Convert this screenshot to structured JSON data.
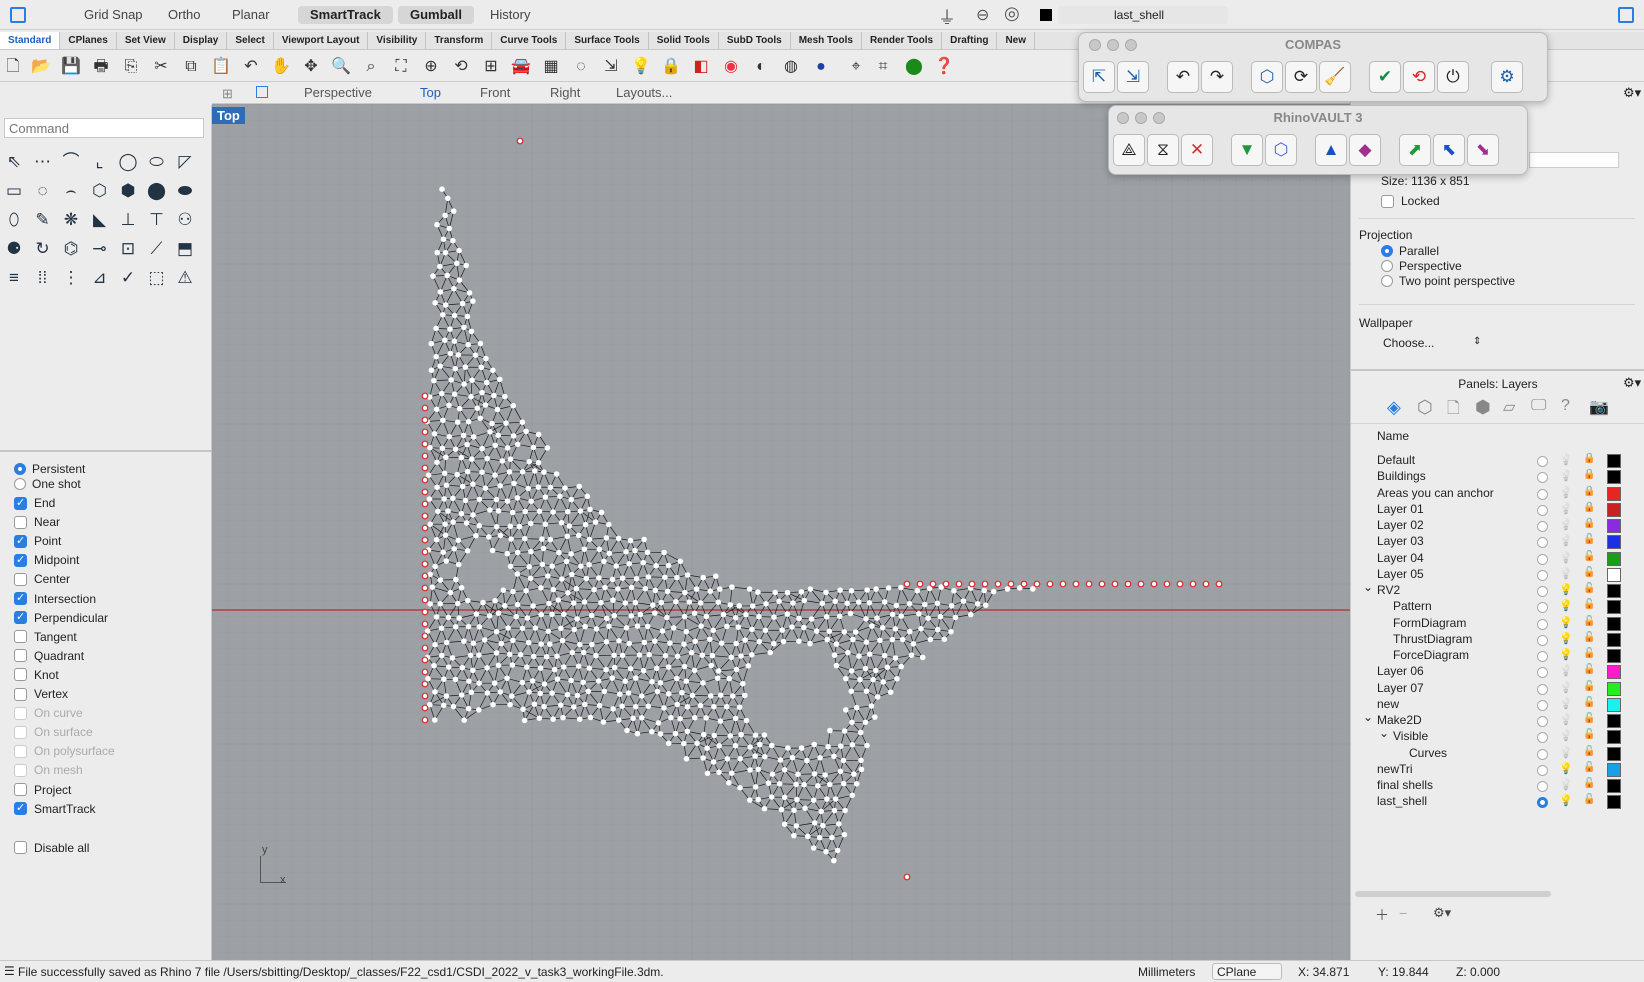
{
  "topbar": {
    "modes": [
      "Grid Snap",
      "Ortho",
      "Planar",
      "SmartTrack",
      "Gumball",
      "History"
    ],
    "active_modes": [
      "SmartTrack",
      "Gumball"
    ],
    "current_layer": "last_shell"
  },
  "tabs": [
    "Standard",
    "CPlanes",
    "Set View",
    "Display",
    "Select",
    "Viewport Layout",
    "Visibility",
    "Transform",
    "Curve Tools",
    "Surface Tools",
    "Solid Tools",
    "SubD Tools",
    "Mesh Tools",
    "Render Tools",
    "Drafting",
    "New"
  ],
  "command": {
    "placeholder": "Command"
  },
  "viewport_tabs": [
    "Perspective",
    "Top",
    "Front",
    "Right",
    "Layouts..."
  ],
  "viewport": {
    "label": "Top",
    "axis_x": "x",
    "axis_y": "y"
  },
  "osnap": {
    "modes": [
      {
        "label": "Persistent",
        "on": true
      },
      {
        "label": "One shot",
        "on": false
      }
    ],
    "items": [
      {
        "label": "End",
        "on": true,
        "enabled": true
      },
      {
        "label": "Near",
        "on": false,
        "enabled": true
      },
      {
        "label": "Point",
        "on": true,
        "enabled": true
      },
      {
        "label": "Midpoint",
        "on": true,
        "enabled": true
      },
      {
        "label": "Center",
        "on": false,
        "enabled": true
      },
      {
        "label": "Intersection",
        "on": true,
        "enabled": true
      },
      {
        "label": "Perpendicular",
        "on": true,
        "enabled": true
      },
      {
        "label": "Tangent",
        "on": false,
        "enabled": true
      },
      {
        "label": "Quadrant",
        "on": false,
        "enabled": true
      },
      {
        "label": "Knot",
        "on": false,
        "enabled": true
      },
      {
        "label": "Vertex",
        "on": false,
        "enabled": true
      },
      {
        "label": "On curve",
        "on": false,
        "enabled": false
      },
      {
        "label": "On surface",
        "on": false,
        "enabled": false
      },
      {
        "label": "On polysurface",
        "on": false,
        "enabled": false
      },
      {
        "label": "On mesh",
        "on": false,
        "enabled": false
      },
      {
        "label": "Project",
        "on": false,
        "enabled": true
      },
      {
        "label": "SmartTrack",
        "on": true,
        "enabled": true
      }
    ],
    "disable_all": "Disable all"
  },
  "properties": {
    "size_label": "Size:",
    "size_value": "1136 x 851",
    "locked": "Locked",
    "projection_title": "Projection",
    "projections": [
      {
        "label": "Parallel",
        "on": true
      },
      {
        "label": "Perspective",
        "on": false
      },
      {
        "label": "Two point perspective",
        "on": false
      }
    ],
    "wallpaper_title": "Wallpaper",
    "wallpaper_choose": "Choose..."
  },
  "layers_panel": {
    "title": "Panels: Layers",
    "name_header": "Name",
    "layers": [
      {
        "name": "Default",
        "indent": 0,
        "color": "#000000",
        "bulb": "off",
        "current": false
      },
      {
        "name": "Buildings",
        "indent": 0,
        "color": "#000000",
        "bulb": "off",
        "current": false
      },
      {
        "name": "Areas you can anchor",
        "indent": 0,
        "color": "#e6261f",
        "bulb": "off",
        "current": false
      },
      {
        "name": "Layer 01",
        "indent": 0,
        "color": "#cc2020",
        "bulb": "off",
        "current": false
      },
      {
        "name": "Layer 02",
        "indent": 0,
        "color": "#8a2be2",
        "bulb": "off",
        "current": false
      },
      {
        "name": "Layer 03",
        "indent": 0,
        "color": "#1a2fe6",
        "bulb": "off",
        "current": false
      },
      {
        "name": "Layer 04",
        "indent": 0,
        "color": "#1a9e1a",
        "bulb": "off",
        "current": false
      },
      {
        "name": "Layer 05",
        "indent": 0,
        "color": "#ffffff",
        "bulb": "off",
        "current": false
      },
      {
        "name": "RV2",
        "indent": 0,
        "color": "#000000",
        "bulb": "on",
        "current": false,
        "expand": true
      },
      {
        "name": "Pattern",
        "indent": 1,
        "color": "#000000",
        "bulb": "on",
        "current": false
      },
      {
        "name": "FormDiagram",
        "indent": 1,
        "color": "#000000",
        "bulb": "on",
        "current": false
      },
      {
        "name": "ThrustDiagram",
        "indent": 1,
        "color": "#000000",
        "bulb": "on",
        "current": false
      },
      {
        "name": "ForceDiagram",
        "indent": 1,
        "color": "#000000",
        "bulb": "on",
        "current": false
      },
      {
        "name": "Layer 06",
        "indent": 0,
        "color": "#ff1acb",
        "bulb": "off",
        "current": false
      },
      {
        "name": "Layer 07",
        "indent": 0,
        "color": "#22ee22",
        "bulb": "off",
        "current": false
      },
      {
        "name": "new",
        "indent": 0,
        "color": "#1af0f0",
        "bulb": "off",
        "current": false
      },
      {
        "name": "Make2D",
        "indent": 0,
        "color": "#000000",
        "bulb": "off",
        "current": false,
        "expand": true
      },
      {
        "name": "Visible",
        "indent": 1,
        "color": "#000000",
        "bulb": "off",
        "current": false,
        "expand": true
      },
      {
        "name": "Curves",
        "indent": 2,
        "color": "#000000",
        "bulb": "off",
        "current": false
      },
      {
        "name": "newTri",
        "indent": 0,
        "color": "#1a9ee6",
        "bulb": "on",
        "current": false
      },
      {
        "name": "final shells",
        "indent": 0,
        "color": "#000000",
        "bulb": "off",
        "current": false
      },
      {
        "name": "last_shell",
        "indent": 0,
        "color": "#000000",
        "bulb": "on",
        "current": true
      }
    ]
  },
  "compas_window": {
    "title": "COMPAS"
  },
  "rhinovault_window": {
    "title": "RhinoVAULT 3"
  },
  "status": {
    "message": "File successfully saved as Rhino 7 file /Users/sbitting/Desktop/_classes/F22_csd1/CSDI_2022_v_task3_workingFile.3dm.",
    "units": "Millimeters",
    "cplane": "CPlane",
    "x": "X: 34.871",
    "y": "Y: 19.844",
    "z": "Z: 0.000"
  },
  "colors": {
    "accent": "#2a7de1",
    "viewport_bg": "#9da1a6",
    "grid": "#8e9297",
    "x_axis": "#b0302a"
  }
}
